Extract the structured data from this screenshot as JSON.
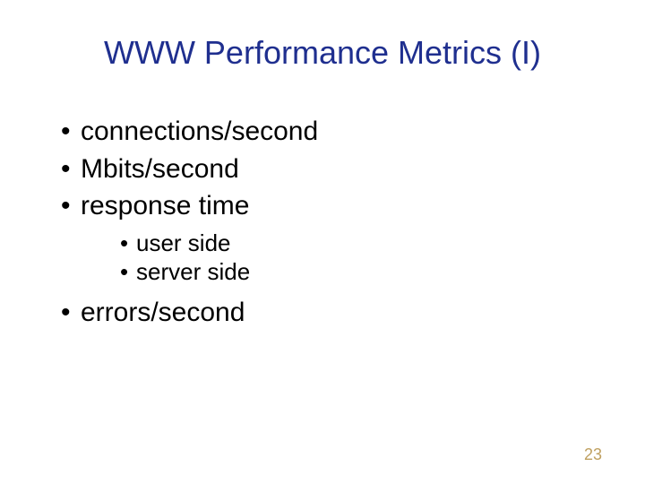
{
  "slide": {
    "title": "WWW Performance Metrics (I)",
    "bullets": {
      "b1": "connections/second",
      "b2": "Mbits/second",
      "b3": "response time",
      "b3_sub": {
        "s1": "user side",
        "s2": "server side"
      },
      "b4": "errors/second"
    },
    "page_number": "23"
  }
}
